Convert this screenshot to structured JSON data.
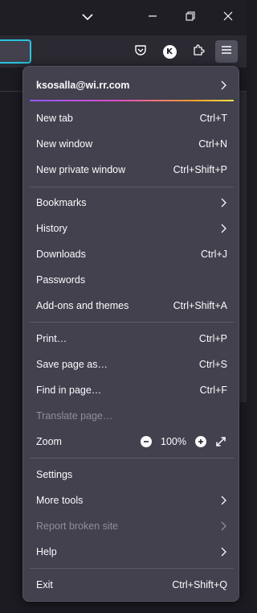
{
  "colors": {
    "background": "#1c1b22",
    "panel": "#42414d",
    "text": "#fbfbfe",
    "disabled_text": "#8f8f9d",
    "url_focus_ring": "#2ac3de"
  },
  "titlebar": {
    "icons": [
      "chevron-down-icon",
      "minimize-icon",
      "restore-icon",
      "close-icon"
    ]
  },
  "navbar": {
    "account_initial": "K",
    "icons": [
      "pocket-icon",
      "account-avatar",
      "extensions-icon",
      "hamburger-menu-icon"
    ]
  },
  "menu": {
    "account": {
      "email": "ksosalla@wi.rr.com"
    },
    "groups": [
      [
        {
          "label": "New tab",
          "shortcut": "Ctrl+T"
        },
        {
          "label": "New window",
          "shortcut": "Ctrl+N"
        },
        {
          "label": "New private window",
          "shortcut": "Ctrl+Shift+P"
        }
      ],
      [
        {
          "label": "Bookmarks",
          "submenu": true
        },
        {
          "label": "History",
          "submenu": true
        },
        {
          "label": "Downloads",
          "shortcut": "Ctrl+J"
        },
        {
          "label": "Passwords"
        },
        {
          "label": "Add-ons and themes",
          "shortcut": "Ctrl+Shift+A"
        }
      ],
      [
        {
          "label": "Print…",
          "shortcut": "Ctrl+P"
        },
        {
          "label": "Save page as…",
          "shortcut": "Ctrl+S"
        },
        {
          "label": "Find in page…",
          "shortcut": "Ctrl+F"
        },
        {
          "label": "Translate page…",
          "disabled": true
        }
      ]
    ],
    "zoom": {
      "label": "Zoom",
      "value": "100%"
    },
    "tools": [
      {
        "label": "Settings"
      },
      {
        "label": "More tools",
        "submenu": true
      },
      {
        "label": "Report broken site",
        "submenu": true,
        "disabled": true
      },
      {
        "label": "Help",
        "submenu": true
      }
    ],
    "exit": {
      "label": "Exit",
      "shortcut": "Ctrl+Shift+Q"
    }
  }
}
